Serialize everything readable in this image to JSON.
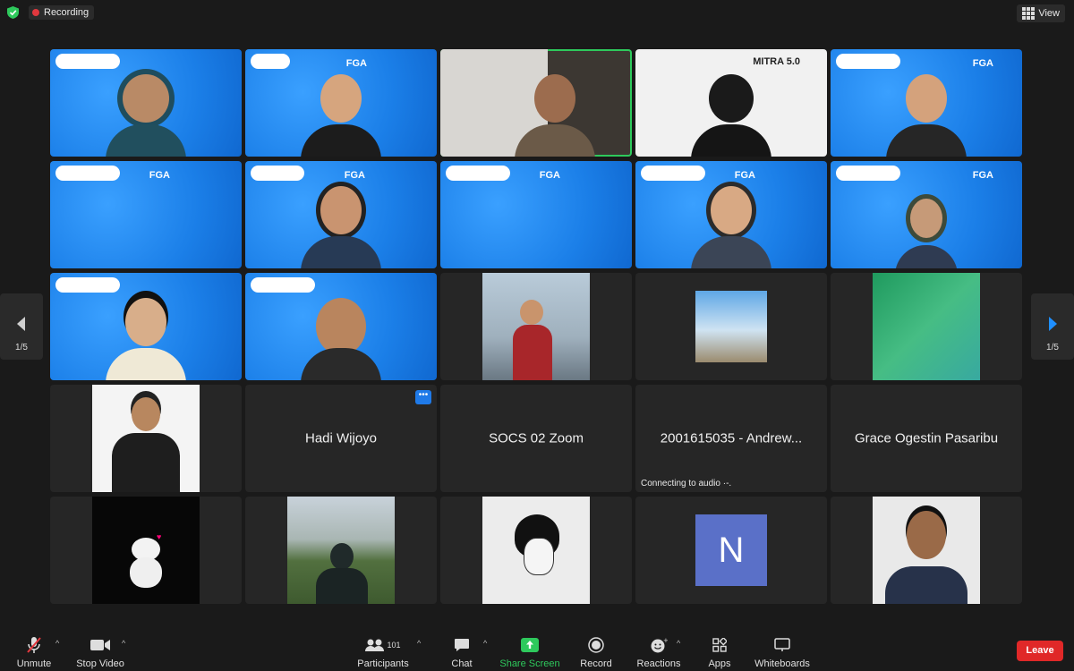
{
  "topbar": {
    "recording_label": "Recording",
    "view_label": "View"
  },
  "nav": {
    "left_page": "1/5",
    "right_page": "1/5"
  },
  "tiles": {
    "fga_text": "FGA",
    "mitra_text": "MITRA 5.0",
    "hadi": "Hadi Wijoyo",
    "socs": "SOCS 02 Zoom",
    "andrew": "2001615035 - Andrew...",
    "grace": "Grace Ogestin Pasaribu",
    "connecting": "Connecting to audio",
    "n_initial": "N"
  },
  "toolbar": {
    "unmute": "Unmute",
    "stop_video": "Stop Video",
    "participants": "Participants",
    "participants_count": "101",
    "chat": "Chat",
    "share_screen": "Share Screen",
    "record": "Record",
    "reactions": "Reactions",
    "apps": "Apps",
    "whiteboards": "Whiteboards",
    "leave": "Leave"
  },
  "colors": {
    "accent_green": "#2ec95c",
    "leave_red": "#e02828",
    "nav_blue": "#1f7ae8"
  }
}
